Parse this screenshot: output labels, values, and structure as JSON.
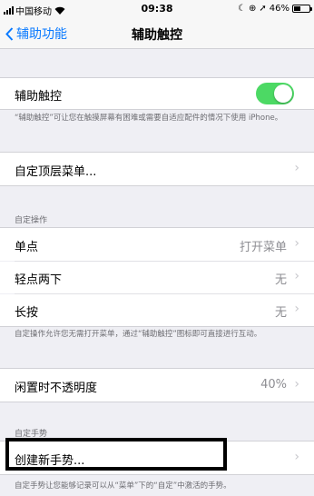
{
  "status": {
    "carrier": "中国移动",
    "time": "09:38",
    "battery_percent": "46%",
    "battery_level": 0.46
  },
  "nav": {
    "back_label": "辅助功能",
    "title": "辅助触控"
  },
  "assistive_touch": {
    "label": "辅助触控",
    "enabled": true,
    "footnote": "“辅助触控”可让您在触摸屏幕有困难或需要自适应配件的情况下使用 iPhone。"
  },
  "customize_menu": {
    "label": "自定顶层菜单..."
  },
  "custom_actions": {
    "header": "自定操作",
    "rows": [
      {
        "label": "单点",
        "value": "打开菜单"
      },
      {
        "label": "轻点两下",
        "value": "无"
      },
      {
        "label": "长按",
        "value": "无"
      }
    ],
    "footnote": "自定操作允许您无需打开菜单，通过“辅助触控”图标即可直接进行互动。"
  },
  "idle_opacity": {
    "label": "闲置时不透明度",
    "value": "40%"
  },
  "custom_gestures": {
    "header": "自定手势",
    "create_label": "创建新手势...",
    "footnote": "自定手势让您能够记录可以从“菜单”下的“自定”中激活的手势。"
  }
}
